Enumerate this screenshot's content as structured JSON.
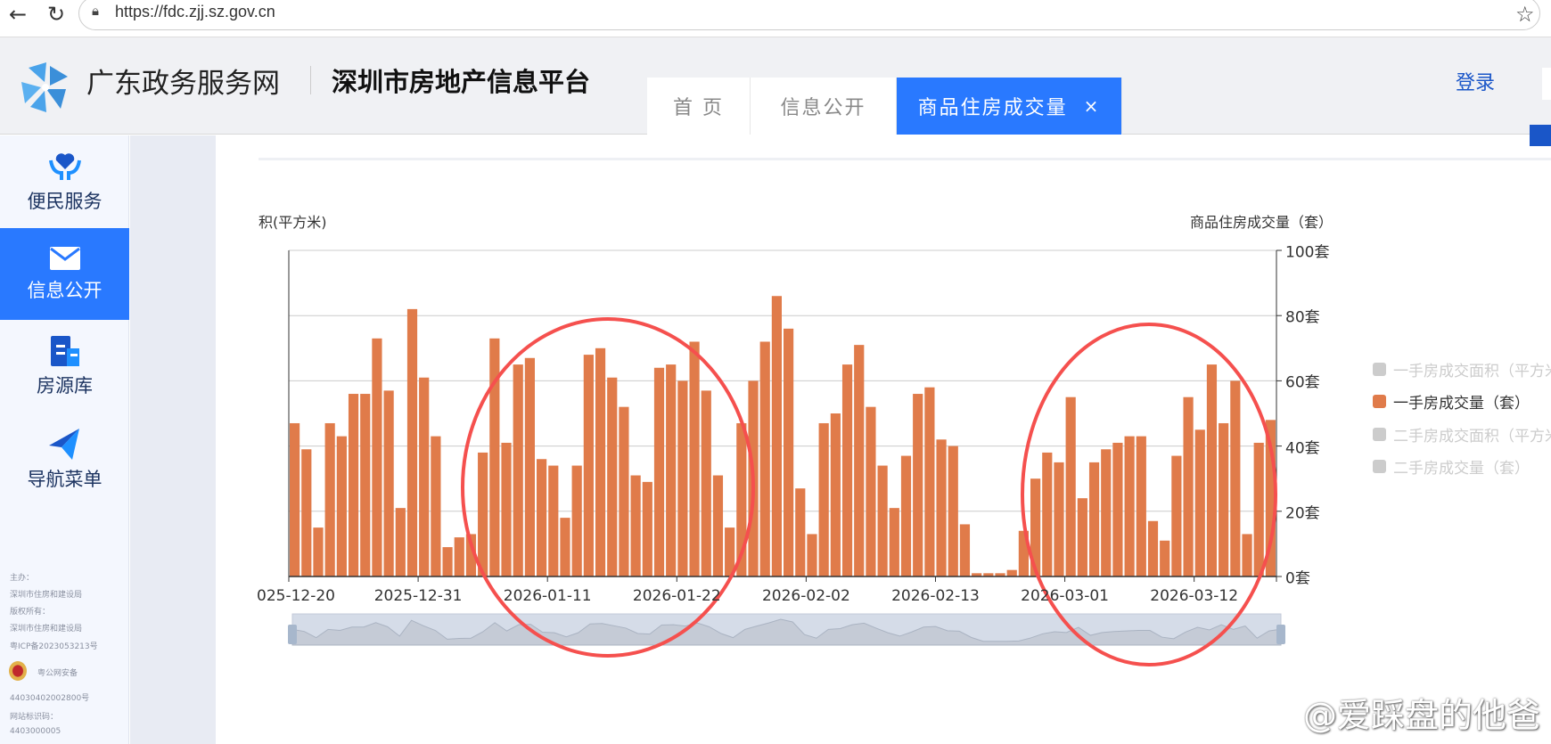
{
  "browser": {
    "url": "https://fdc.zjj.sz.gov.cn"
  },
  "header": {
    "site_name": "广东政务服务网",
    "platform_name": "深圳市房地产信息平台",
    "login": "登录",
    "tabs": [
      {
        "label": "首 页"
      },
      {
        "label": "信息公开"
      },
      {
        "label": "商品住房成交量",
        "close": "×"
      }
    ]
  },
  "sidebar": {
    "items": [
      {
        "label": "便民服务",
        "icon": "heart-hands-icon"
      },
      {
        "label": "信息公开",
        "icon": "mail-icon"
      },
      {
        "label": "房源库",
        "icon": "building-icon"
      },
      {
        "label": "导航菜单",
        "icon": "paper-plane-icon"
      }
    ],
    "footer": [
      "主办：",
      "深圳市住房和建设局",
      "版权所有：",
      "深圳市住房和建设局",
      "粤ICP备2023053213号",
      "粤公网安备",
      "44030402002800号",
      "网站标识码：",
      "4403000005"
    ]
  },
  "chart_data": {
    "type": "bar",
    "left_axis_label": "积(平方米)",
    "right_axis_label": "商品住房成交量（套）",
    "yticks": [
      "0套",
      "20套",
      "40套",
      "60套",
      "80套",
      "100套"
    ],
    "ylim": [
      0,
      100
    ],
    "xtick_labels": [
      "025-12-20",
      "2025-12-31",
      "2026-01-11",
      "2026-01-22",
      "2026-02-02",
      "2026-02-13",
      "2026-03-01",
      "2026-03-12"
    ],
    "xtick_every": 11,
    "series": [
      {
        "name": "一手房成交量（套）",
        "color": "#e07b4a",
        "values": [
          47,
          39,
          15,
          47,
          43,
          56,
          56,
          73,
          57,
          21,
          82,
          61,
          43,
          9,
          12,
          13,
          38,
          73,
          41,
          65,
          67,
          36,
          34,
          18,
          34,
          68,
          70,
          61,
          52,
          31,
          29,
          64,
          65,
          60,
          72,
          57,
          31,
          15,
          47,
          60,
          72,
          86,
          76,
          27,
          13,
          47,
          50,
          65,
          71,
          52,
          34,
          21,
          37,
          56,
          58,
          42,
          40,
          16,
          1,
          1,
          1,
          2,
          14,
          30,
          38,
          35,
          55,
          24,
          35,
          39,
          41,
          43,
          43,
          17,
          11,
          37,
          55,
          45,
          65,
          47,
          60,
          13,
          41,
          48
        ]
      }
    ],
    "legend": [
      {
        "label": "一手房成交面积（平方米）",
        "active": false
      },
      {
        "label": "一手房成交量（套）",
        "active": true
      },
      {
        "label": "二手房成交面积（平方米）",
        "active": false
      },
      {
        "label": "二手房成交量（套）",
        "active": false
      }
    ],
    "legend_position": "right"
  },
  "watermark": "@爱踩盘的他爸"
}
